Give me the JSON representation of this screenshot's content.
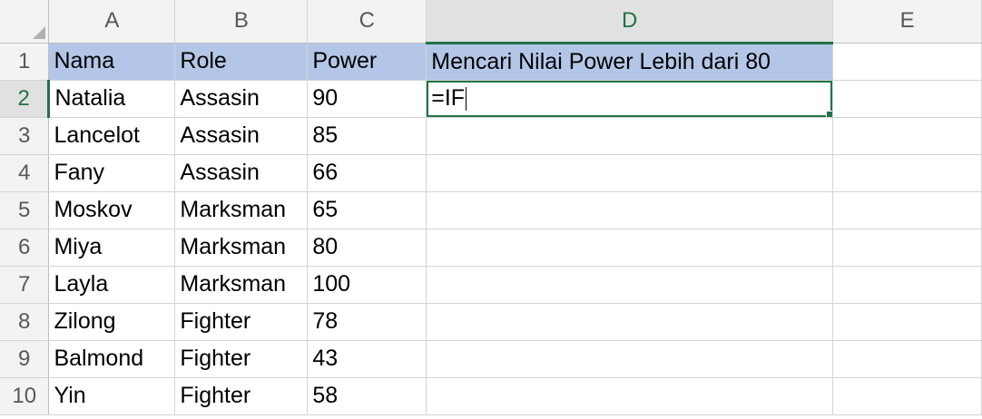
{
  "sheet": {
    "columns": [
      "A",
      "B",
      "C",
      "D",
      "E"
    ],
    "active_column": "D",
    "active_row": "2",
    "rows": [
      {
        "num": "1",
        "cells": [
          "Nama",
          "Role",
          "Power",
          "Mencari Nilai Power Lebih dari 80",
          ""
        ]
      },
      {
        "num": "2",
        "cells": [
          "Natalia",
          "Assasin",
          "90",
          "=IF",
          ""
        ]
      },
      {
        "num": "3",
        "cells": [
          "Lancelot",
          "Assasin",
          "85",
          "",
          ""
        ]
      },
      {
        "num": "4",
        "cells": [
          "Fany",
          "Assasin",
          "66",
          "",
          ""
        ]
      },
      {
        "num": "5",
        "cells": [
          "Moskov",
          "Marksman",
          "65",
          "",
          ""
        ]
      },
      {
        "num": "6",
        "cells": [
          "Miya",
          "Marksman",
          "80",
          "",
          ""
        ]
      },
      {
        "num": "7",
        "cells": [
          "Layla",
          "Marksman",
          "100",
          "",
          ""
        ]
      },
      {
        "num": "8",
        "cells": [
          "Zilong",
          "Fighter",
          "78",
          "",
          ""
        ]
      },
      {
        "num": "9",
        "cells": [
          "Balmond",
          "Fighter",
          "43",
          "",
          ""
        ]
      },
      {
        "num": "10",
        "cells": [
          "Yin",
          "Fighter",
          "58",
          "",
          ""
        ]
      }
    ]
  },
  "colors": {
    "header_fill": "#b4c6e7",
    "selection": "#217346"
  }
}
